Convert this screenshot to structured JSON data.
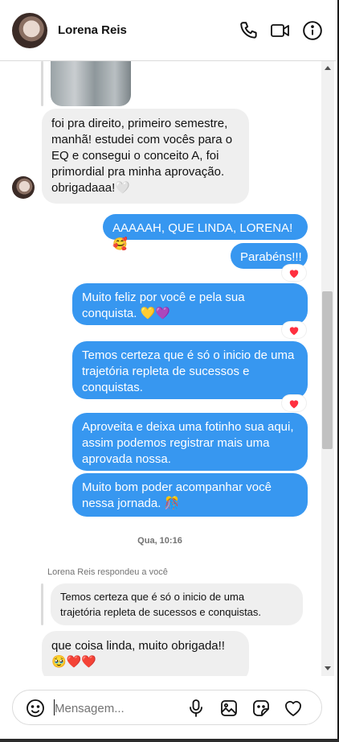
{
  "header": {
    "name": "Lorena Reis",
    "call_icon": "phone-icon",
    "video_icon": "video-icon",
    "info_icon": "info-icon"
  },
  "messages": {
    "incoming_1": [
      "foi pra direito, primeiro semestre,",
      "manhã! estudei com vocês para o",
      "EQ e consegui o conceito A, foi",
      "primordial pra minha aprovação.",
      "obrigadaaa!🤍"
    ],
    "outgoing_1": "AAAAAH, QUE LINDA, LORENA! 🥰",
    "outgoing_2": "Parabéns!!!",
    "outgoing_3": [
      "Muito feliz por você e pela sua",
      "conquista. 💛💜"
    ],
    "outgoing_4": [
      "Temos certeza que é só o inicio de uma",
      "trajetória repleta de sucessos e",
      "conquistas."
    ],
    "outgoing_5": [
      "Aproveita e deixa uma fotinho sua aqui,",
      "assim podemos registrar mais uma",
      "aprovada nossa."
    ],
    "outgoing_6": [
      "Muito bom poder acompanhar você",
      "nessa jornada. 🎊"
    ]
  },
  "timestamp": "Qua, 10:16",
  "reply": {
    "label": "Lorena Reis respondeu a você",
    "quoted": [
      "Temos certeza que é só o inicio de uma",
      "trajetória repleta de sucessos e conquistas."
    ],
    "message": [
      "que coisa linda, muito obrigada!!",
      "🥹❤️❤️"
    ]
  },
  "composer": {
    "placeholder": "Mensagem..."
  },
  "colors": {
    "outgoing_bubble": "#3797f0",
    "incoming_bubble": "#efefef",
    "heart": "#ff3040"
  }
}
